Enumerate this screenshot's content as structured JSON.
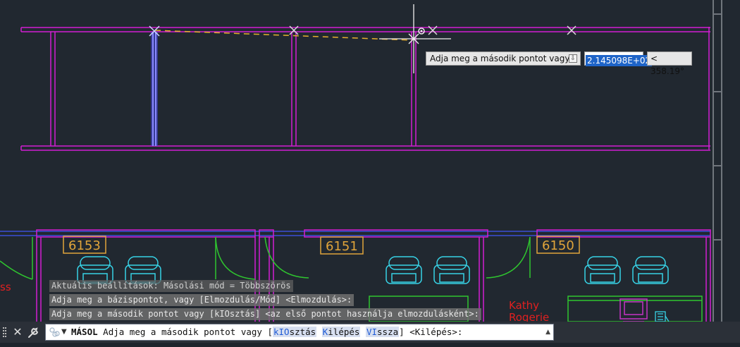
{
  "rooms": [
    {
      "number": "6153"
    },
    {
      "number": "6151"
    },
    {
      "number": "6150"
    }
  ],
  "labels": {
    "partial_name": "ss",
    "occupant_first": "Kathy",
    "occupant_last": "Rogerie"
  },
  "dynamic_input": {
    "prompt": "Adja meg a második pontot vagy",
    "value": "2.145098E+02",
    "angle": "< 358.19°"
  },
  "history": [
    "Aktuális beállítások:  Másolási mód = Többszörös",
    "Adja meg a bázispontot, vagy [Elmozdulás/Mód] <Elmozdulás>:",
    "Adja meg a második pontot vagy [kIOsztás] <az első pontot használja elmozdulásként>:"
  ],
  "command_line": {
    "command": "MÁSOL",
    "prompt": "Adja meg a második pontot vagy [",
    "options": [
      {
        "hot": "kIO",
        "rest": "sztás",
        "label": "kIOsztás"
      },
      {
        "hot": "K",
        "rest": "ilépés",
        "label": "Kilépés"
      },
      {
        "hot": "VI",
        "rest": "ssza",
        "label": "VIssza"
      }
    ],
    "suffix": "] <Kilépés>:"
  },
  "colors": {
    "background": "#212830",
    "wall": "#d21ed2",
    "door": "#2fc52f",
    "furniture": "#37d2e6",
    "room_tag": "#e0a43a",
    "text_red": "#e02020",
    "rubberband": "#e6b02e",
    "selection": "#5a5aff"
  },
  "icons": [
    "close-icon",
    "wrench-icon",
    "command-icon",
    "chevron-down-icon",
    "scroll-up-icon",
    "download-icon"
  ]
}
